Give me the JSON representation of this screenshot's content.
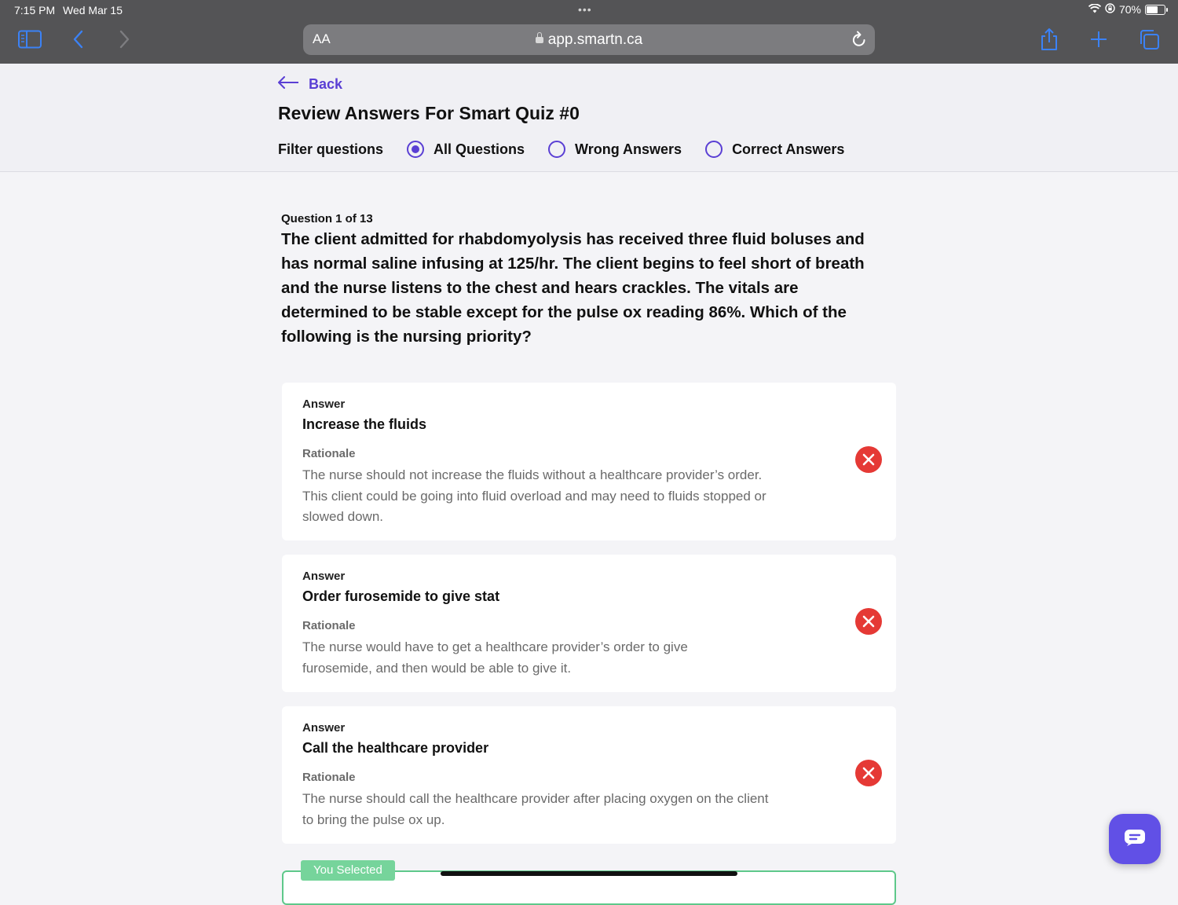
{
  "status_bar": {
    "time": "7:15 PM",
    "date": "Wed Mar 15",
    "battery": "70%",
    "battery_level": 0.7
  },
  "browser": {
    "aa_label": "AA",
    "url": "app.smartn.ca"
  },
  "header": {
    "back_label": "Back",
    "title": "Review Answers For Smart Quiz #0",
    "filter_label": "Filter questions",
    "filters": [
      {
        "label": "All Questions",
        "checked": true
      },
      {
        "label": "Wrong Answers",
        "checked": false
      },
      {
        "label": "Correct Answers",
        "checked": false
      }
    ]
  },
  "question": {
    "counter": "Question 1 of 13",
    "text": "The client admitted for rhabdomyolysis has received three fluid boluses and has normal saline infusing at 125/hr. The client begins to feel short of breath and the nurse listens to the chest and hears crackles. The vitals are determined to be stable except for the pulse ox reading 86%. Which of the following is the nursing priority?"
  },
  "answers": [
    {
      "answer_label": "Answer",
      "answer": "Increase the fluids",
      "rationale_label": "Rationale",
      "rationale": "The nurse should not increase the fluids without a healthcare provider’s order. This client could be going into fluid overload and may need to fluids stopped or slowed down.",
      "status": "wrong"
    },
    {
      "answer_label": "Answer",
      "answer": "Order furosemide to give stat",
      "rationale_label": "Rationale",
      "rationale": "The nurse would have to get a healthcare provider’s order to give furosemide, and then would be able to give it.",
      "status": "wrong"
    },
    {
      "answer_label": "Answer",
      "answer": "Call the healthcare provider",
      "rationale_label": "Rationale",
      "rationale": "The nurse should call the healthcare provider after placing oxygen on the client to bring the pulse ox up.",
      "status": "wrong"
    }
  ],
  "selected_badge": "You Selected",
  "colors": {
    "accent": "#5a3fd4",
    "wrong": "#e53935",
    "selected": "#5ec88a",
    "chat": "#6150e6"
  }
}
